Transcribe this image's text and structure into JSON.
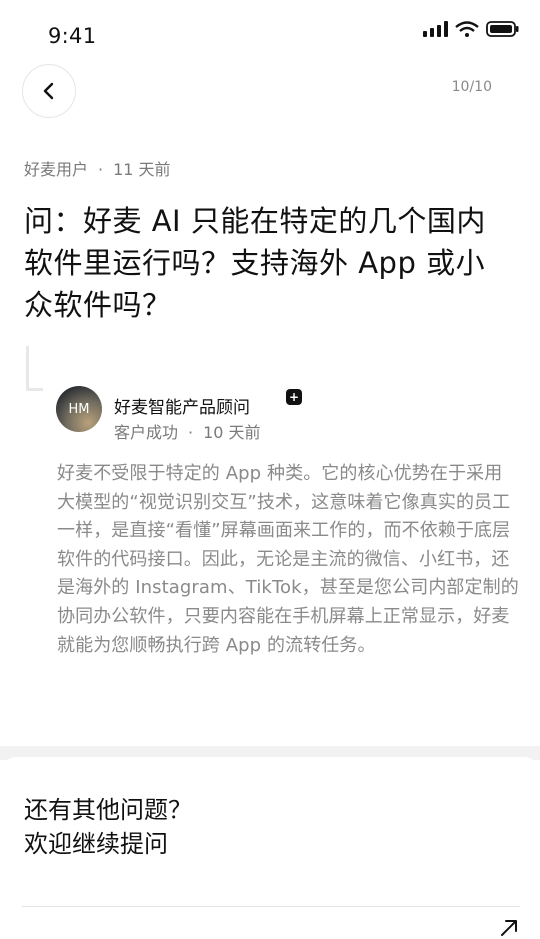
{
  "status_bar": {
    "time": "9:41"
  },
  "header": {
    "page_indicator": "10/10"
  },
  "question": {
    "author": "好麦用户",
    "separator": "·",
    "time_ago": "11 天前",
    "text": "问：好麦 AI 只能在特定的几个国内软件里运行吗？支持海外 App 或小众软件吗？"
  },
  "answer": {
    "avatar_initials": "HM",
    "name": "好麦智能产品顾问",
    "badge": "+",
    "role": "客户成功",
    "separator": "·",
    "time_ago": "10 天前",
    "text": "好麦不受限于特定的 App 种类。它的核心优势在于采用大模型的“视觉识别交互”技术，这意味着它像真实的员工一样，是直接“看懂”屏幕画面来工作的，而不依赖于底层软件的代码接口。因此，无论是主流的微信、小红书，还是海外的 Instagram、TikTok，甚至是您公司内部定制的协同办公软件，只要内容能在手机屏幕上正常显示，好麦就能为您顺畅执行跨 App 的流转任务。"
  },
  "bottom": {
    "title_line1": "还有其他问题？",
    "title_line2": "欢迎继续提问"
  }
}
